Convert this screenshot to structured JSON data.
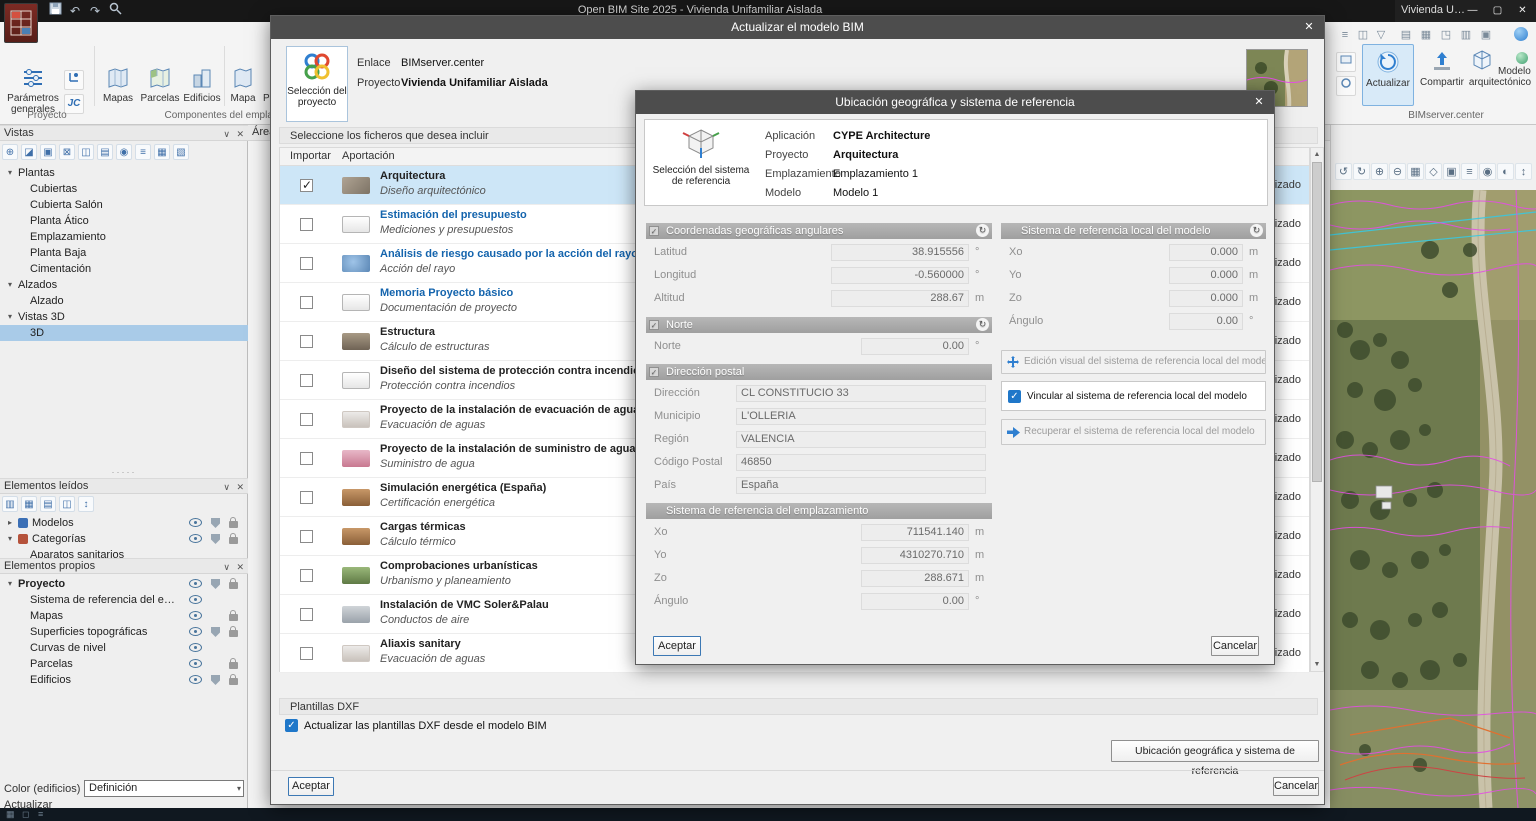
{
  "icons": {
    "undo": "↶",
    "redo": "↷",
    "check": "✓",
    "close": "✕",
    "minimize": "—",
    "maximize": "▢",
    "chev_down": "▾",
    "chev_right": "▸",
    "panel_collapse": "∨",
    "panel_close": "✕",
    "dropdown": "▾",
    "scroll_up": "▲",
    "scroll_down": "▼",
    "splitter": "·····",
    "refresh": "↻",
    "vistas_toolbar": [
      "⊕",
      "◪",
      "▣",
      "⊠",
      "◫",
      "▤",
      "◉",
      "≡",
      "▦",
      "▧"
    ],
    "leidos_toolbar": [
      "▥",
      "▦",
      "▤",
      "◫",
      "↕"
    ],
    "quick_toolbar": [
      "≡",
      "◫",
      "▽"
    ],
    "window_toolbar": [
      "▤",
      "▦",
      "◳",
      "▥",
      "▣"
    ],
    "status_toolbar": [
      "▦",
      "◻",
      "≡"
    ],
    "viewport_toolbar": [
      "↺",
      "↻",
      "⊕",
      "⊖",
      "▦",
      "◇",
      "▣",
      "≡",
      "◉",
      "◐",
      "↕"
    ]
  },
  "titlebar": {
    "title": "Open BIM Site 2025 - Vivienda Unifamiliar Aislada"
  },
  "secondary_window": {
    "title": "Vivienda Unifamiliar Aislada"
  },
  "ribbon": {
    "group1": {
      "label": "Proyecto",
      "button1": "Parámetros generales",
      "small_button": "JC"
    },
    "group2": {
      "label": "Componentes del emplazamiento",
      "buttons": [
        "Mapas",
        "Parcelas",
        "Edificios",
        "Mapa",
        "Parcela"
      ]
    },
    "group_right": {
      "label": "BIMserver.center",
      "buttons": [
        "Actualizar",
        "Compartir",
        "Modelo arquitectónico"
      ]
    }
  },
  "panels": {
    "area_label": "Área",
    "vistas": {
      "title": "Vistas",
      "groups": [
        {
          "label": "Plantas",
          "items": [
            "Cubiertas",
            "Cubierta Salón",
            "Planta Ático",
            "Emplazamiento",
            "Planta Baja",
            "Cimentación"
          ]
        },
        {
          "label": "Alzados",
          "items": [
            "Alzado"
          ]
        },
        {
          "label": "Vistas 3D",
          "items": [
            "3D"
          ]
        }
      ]
    },
    "leidos": {
      "title": "Elementos leídos",
      "rows": [
        "Modelos",
        "Categorías",
        "Aparatos sanitarios"
      ]
    },
    "propios": {
      "title": "Elementos propios",
      "root": "Proyecto",
      "items": [
        "Sistema de referencia del emplazamiento",
        "Mapas",
        "Superficies topográficas",
        "Curvas de nivel",
        "Parcelas",
        "Edificios"
      ]
    },
    "color_label": "Color (edificios)",
    "color_value": "Definición",
    "bottom_label": "Actualizar"
  },
  "dialog_update": {
    "title": "Actualizar el modelo BIM",
    "project_tile": "Selección del proyecto",
    "enlace_label": "Enlace",
    "enlace_value": "BIMserver.center",
    "proyecto_label": "Proyecto",
    "proyecto_value": "Vivienda Unifamiliar Aislada",
    "files_header": "Seleccione los ficheros que desea incluir",
    "col_importar": "Importar",
    "col_aportacion": "Aportación",
    "rows": [
      {
        "title": "Arquitectura",
        "subtitle": "Diseño arquitectónico",
        "status": "Actualizado"
      },
      {
        "title": "Estimación del presupuesto",
        "subtitle": "Mediciones y presupuestos",
        "status": "Actualizado"
      },
      {
        "title": "Análisis de riesgo causado por la acción del rayo (CTE DB S",
        "subtitle": "Acción del rayo",
        "status": "Actualizado"
      },
      {
        "title": "Memoria Proyecto básico",
        "subtitle": "Documentación de proyecto",
        "status": "Actualizado"
      },
      {
        "title": "Estructura",
        "subtitle": "Cálculo de estructuras",
        "status": "Actualizado"
      },
      {
        "title": "Diseño del sistema de protección contra incendios",
        "subtitle": "Protección contra incendios",
        "status": "Actualizado"
      },
      {
        "title": "Proyecto de la instalación de evacuación de aguas",
        "subtitle": "Evacuación de aguas",
        "status": "Actualizado"
      },
      {
        "title": "Proyecto de la instalación de suministro de agua",
        "subtitle": "Suministro de agua",
        "status": "Actualizado"
      },
      {
        "title": "Simulación energética (España)",
        "subtitle": "Certificación energética",
        "status": "Actualizado"
      },
      {
        "title": "Cargas térmicas",
        "subtitle": "Cálculo térmico",
        "status": "Actualizado"
      },
      {
        "title": "Comprobaciones urbanísticas",
        "subtitle": "Urbanismo y planeamiento",
        "status": "Actualizado"
      },
      {
        "title": "Instalación de VMC Soler&Palau",
        "subtitle": "Conductos de aire",
        "status": "Actualizado"
      },
      {
        "title": "Aliaxis sanitary",
        "subtitle": "Evacuación de aguas",
        "status": "Actualizado"
      }
    ],
    "dxf_header": "Plantillas DXF",
    "dxf_checkbox": "Actualizar las plantillas DXF desde el modelo BIM",
    "location_button": "Ubicación geográfica y sistema de referencia",
    "accept": "Aceptar",
    "cancel": "Cancelar"
  },
  "dialog_location": {
    "title": "Ubicación geográfica y sistema de referencia",
    "selector_label": "Selección del sistema de referencia",
    "info": [
      {
        "label": "Aplicación",
        "value": "CYPE Architecture"
      },
      {
        "label": "Proyecto",
        "value": "Arquitectura"
      },
      {
        "label": "Emplazamiento",
        "value": "Emplazamiento 1"
      },
      {
        "label": "Modelo",
        "value": "Modelo 1"
      }
    ],
    "coords": {
      "title": "Coordenadas geográficas angulares",
      "fields": [
        {
          "label": "Latitud",
          "value": "38.915556",
          "unit": "°"
        },
        {
          "label": "Longitud",
          "value": "-0.560000",
          "unit": "°"
        },
        {
          "label": "Altitud",
          "value": "288.67",
          "unit": "m"
        }
      ]
    },
    "norte": {
      "title": "Norte",
      "fields": [
        {
          "label": "Norte",
          "value": "0.00",
          "unit": "°"
        }
      ]
    },
    "postal": {
      "title": "Dirección postal",
      "fields": [
        {
          "label": "Dirección",
          "value": "CL CONSTITUCIO 33"
        },
        {
          "label": "Municipio",
          "value": "L'OLLERIA"
        },
        {
          "label": "Región",
          "value": "VALENCIA"
        },
        {
          "label": "Código Postal",
          "value": "46850"
        },
        {
          "label": "País",
          "value": "España"
        }
      ]
    },
    "site_ref": {
      "title": "Sistema de referencia del emplazamiento",
      "fields": [
        {
          "label": "Xo",
          "value": "711541.140",
          "unit": "m"
        },
        {
          "label": "Yo",
          "value": "4310270.710",
          "unit": "m"
        },
        {
          "label": "Zo",
          "value": "288.671",
          "unit": "m"
        },
        {
          "label": "Ángulo",
          "value": "0.00",
          "unit": "°"
        }
      ]
    },
    "local_ref": {
      "title": "Sistema de referencia local del modelo",
      "fields": [
        {
          "label": "Xo",
          "value": "0.000",
          "unit": "m"
        },
        {
          "label": "Yo",
          "value": "0.000",
          "unit": "m"
        },
        {
          "label": "Zo",
          "value": "0.000",
          "unit": "m"
        },
        {
          "label": "Ángulo",
          "value": "0.00",
          "unit": "°"
        }
      ]
    },
    "edit_button": "Edición visual del sistema de referencia local del modelo",
    "link_checkbox": "Vincular al sistema de referencia local del modelo",
    "recover_button": "Recuperar el sistema de referencia local del modelo",
    "accept": "Aceptar",
    "cancel": "Cancelar"
  }
}
